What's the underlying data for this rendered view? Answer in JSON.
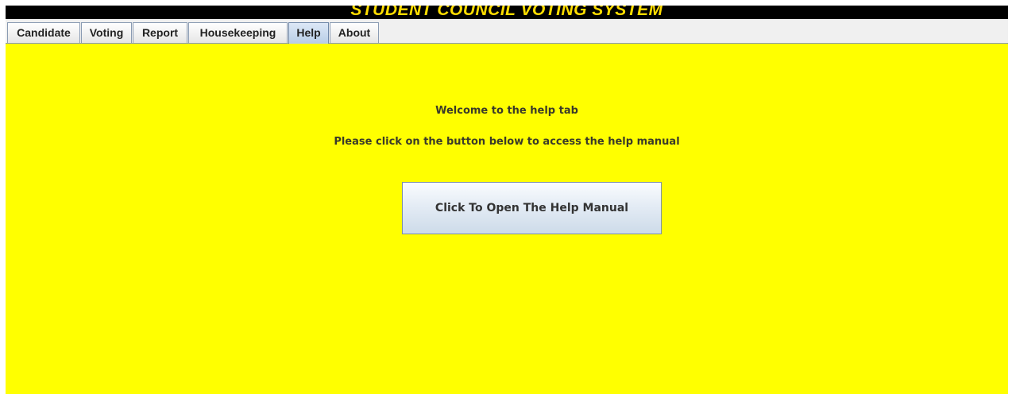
{
  "window": {
    "title": "STUDENT COUNCIL VOTING SYSTEM"
  },
  "tabs": [
    {
      "label": "Candidate",
      "selected": false
    },
    {
      "label": "Voting",
      "selected": false
    },
    {
      "label": "Report",
      "selected": false
    },
    {
      "label": "Housekeeping",
      "selected": false
    },
    {
      "label": "Help",
      "selected": true
    },
    {
      "label": "About",
      "selected": false
    }
  ],
  "help": {
    "welcome_text": "Welcome to the help tab",
    "instruction_text": "Please click on the button below to access the help manual",
    "open_manual_button": "Click To Open The Help Manual"
  },
  "colors": {
    "background": "#ffff00",
    "title_bar": "#000000",
    "title_text": "#ffdd00"
  }
}
